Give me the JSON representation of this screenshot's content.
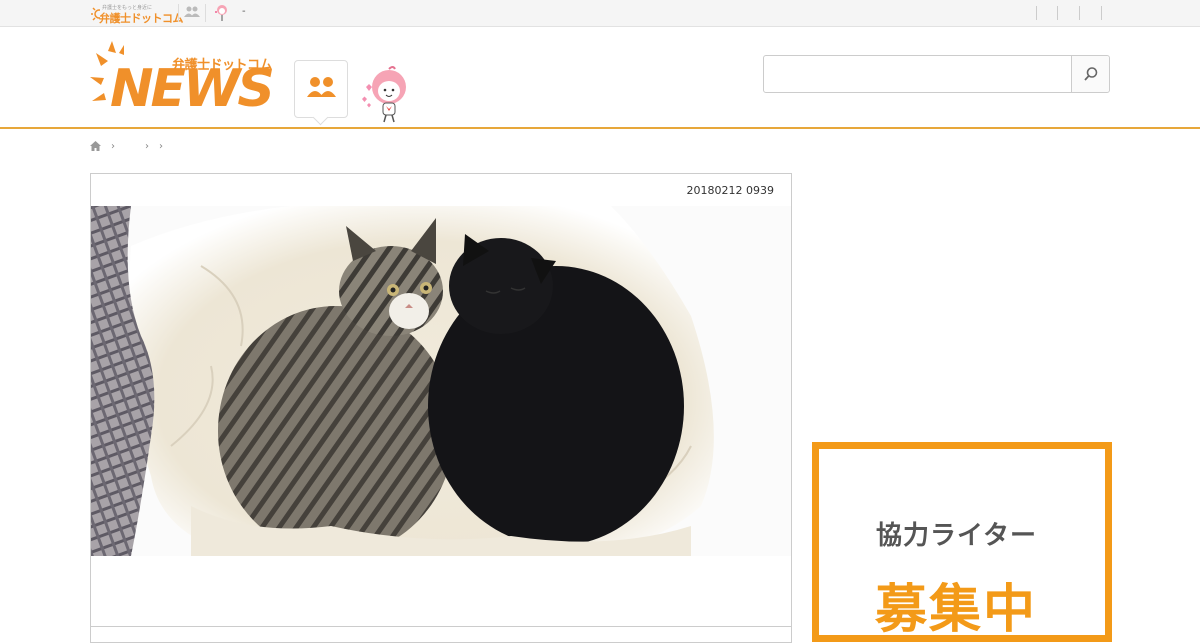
{
  "topbar": {
    "logo_tagline": "弁護士をもっと身近に",
    "logo_name": "弁護士ドットコム",
    "dash": "-"
  },
  "header": {
    "brand_small": "弁護士ドットコム",
    "brand_large": "NEWS",
    "search": {
      "value": "",
      "placeholder": ""
    }
  },
  "breadcrumb": {
    "separator": "›"
  },
  "article": {
    "date": "20180212 0939",
    "photo_icon": "two-cats-photo"
  },
  "ad": {
    "line1": "協力ライター",
    "line2": "募集中"
  },
  "colors": {
    "brand_orange": "#f0902a",
    "header_rule": "#e7a73a",
    "ad_border": "#f39a18"
  }
}
